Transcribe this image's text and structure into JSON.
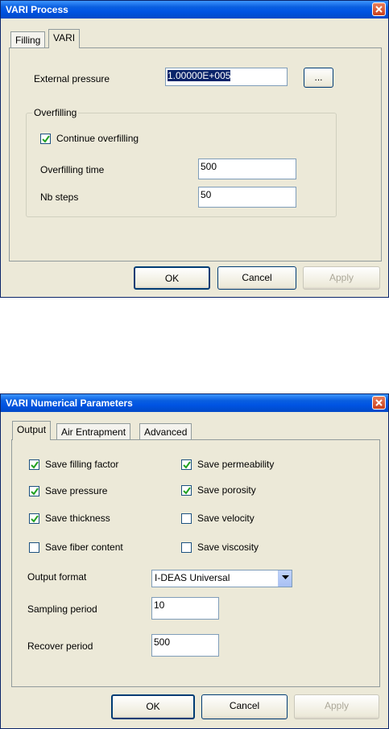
{
  "dialog1": {
    "title": "VARI Process",
    "tabs": [
      "Filling",
      "VARI"
    ],
    "external_pressure_label": "External pressure",
    "external_pressure_value": "1.00000E+005",
    "browse_label": "...",
    "group_overfilling_label": "Overfilling",
    "continue_overfilling_label": "Continue overfilling",
    "continue_overfilling_checked": true,
    "overfilling_time_label": "Overfilling time",
    "overfilling_time_value": "500",
    "nb_steps_label": "Nb steps",
    "nb_steps_value": "50",
    "buttons": {
      "ok": "OK",
      "cancel": "Cancel",
      "apply": "Apply"
    }
  },
  "dialog2": {
    "title": "VARI Numerical Parameters",
    "tabs": [
      "Output",
      "Air Entrapment",
      "Advanced"
    ],
    "checkboxes": [
      {
        "label": "Save filling factor",
        "checked": true
      },
      {
        "label": "Save permeability",
        "checked": true
      },
      {
        "label": "Save pressure",
        "checked": true
      },
      {
        "label": "Save porosity",
        "checked": true
      },
      {
        "label": "Save thickness",
        "checked": true
      },
      {
        "label": "Save velocity",
        "checked": false
      },
      {
        "label": "Save fiber content",
        "checked": false
      },
      {
        "label": "Save viscosity",
        "checked": false
      }
    ],
    "output_format_label": "Output format",
    "output_format_value": "I-DEAS Universal",
    "sampling_period_label": "Sampling period",
    "sampling_period_value": "10",
    "recover_period_label": "Recover period",
    "recover_period_value": "500",
    "buttons": {
      "ok": "OK",
      "cancel": "Cancel",
      "apply": "Apply"
    }
  },
  "colors": {
    "titlebar": "#0054e3",
    "dialog_bg": "#ece9d8",
    "selection": "#0a246a"
  }
}
